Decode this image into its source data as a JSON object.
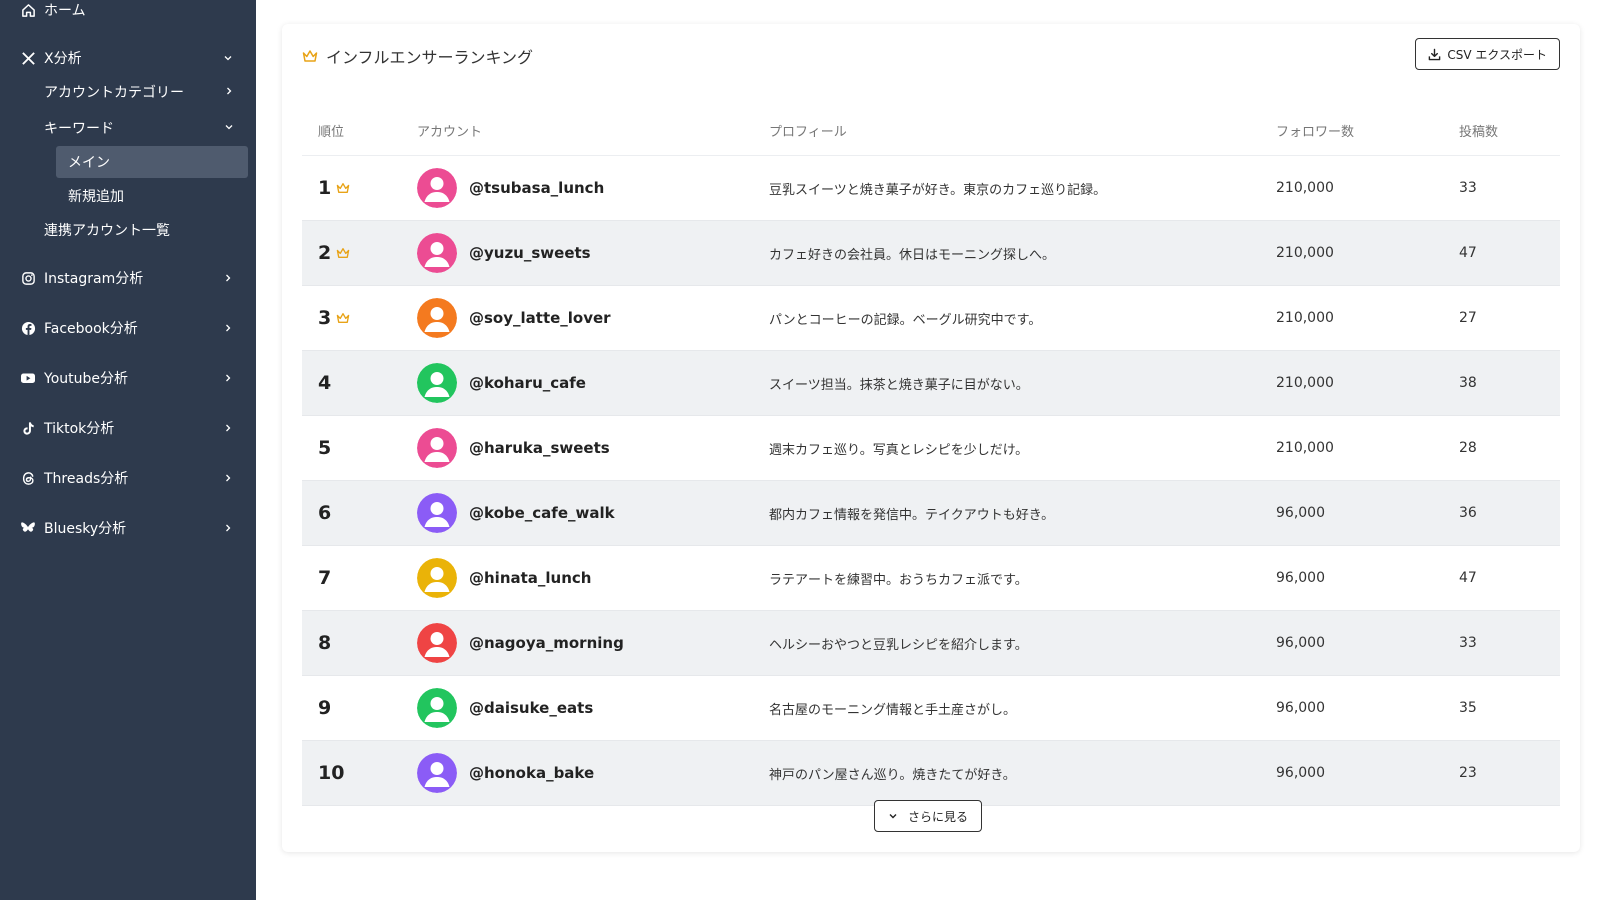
{
  "sidebar": {
    "home": "ホーム",
    "x": {
      "label": "X分析",
      "account_category": "アカウントカテゴリー",
      "keyword": "キーワード",
      "keyword_main": "メイン",
      "keyword_new": "新規追加",
      "linked_accounts": "連携アカウント一覧"
    },
    "platforms": [
      {
        "label": "Instagram分析",
        "icon": "instagram-icon"
      },
      {
        "label": "Facebook分析",
        "icon": "facebook-icon"
      },
      {
        "label": "Youtube分析",
        "icon": "youtube-icon"
      },
      {
        "label": "Tiktok分析",
        "icon": "tiktok-icon"
      },
      {
        "label": "Threads分析",
        "icon": "threads-icon"
      },
      {
        "label": "Bluesky分析",
        "icon": "bluesky-icon"
      }
    ]
  },
  "ranking": {
    "title": "インフルエンサーランキング",
    "export_label": "CSV エクスポート",
    "more_label": "さらに見る",
    "columns": {
      "rank": "順位",
      "account": "アカウント",
      "profile": "プロフィール",
      "followers": "フォロワー数",
      "posts": "投稿数"
    },
    "crown_color": "#e8a317",
    "rows": [
      {
        "rank": "1",
        "handle": "@tsubasa_lunch",
        "profile": "豆乳スイーツと焼き菓子が好き。東京のカフェ巡り記録。",
        "followers": "210,000",
        "posts": "33",
        "avatar_color": "#ec4c93",
        "crown": true
      },
      {
        "rank": "2",
        "handle": "@yuzu_sweets",
        "profile": "カフェ好きの会社員。休日はモーニング探しへ。",
        "followers": "210,000",
        "posts": "47",
        "avatar_color": "#ec4c93",
        "crown": true
      },
      {
        "rank": "3",
        "handle": "@soy_latte_lover",
        "profile": "パンとコーヒーの記録。ベーグル研究中です。",
        "followers": "210,000",
        "posts": "27",
        "avatar_color": "#f47a1f",
        "crown": true
      },
      {
        "rank": "4",
        "handle": "@koharu_cafe",
        "profile": "スイーツ担当。抹茶と焼き菓子に目がない。",
        "followers": "210,000",
        "posts": "38",
        "avatar_color": "#22c55e",
        "crown": false
      },
      {
        "rank": "5",
        "handle": "@haruka_sweets",
        "profile": "週末カフェ巡り。写真とレシピを少しだけ。",
        "followers": "210,000",
        "posts": "28",
        "avatar_color": "#ec4c93",
        "crown": false
      },
      {
        "rank": "6",
        "handle": "@kobe_cafe_walk",
        "profile": "都内カフェ情報を発信中。テイクアウトも好き。",
        "followers": "96,000",
        "posts": "36",
        "avatar_color": "#8b5cf6",
        "crown": false
      },
      {
        "rank": "7",
        "handle": "@hinata_lunch",
        "profile": "ラテアートを練習中。おうちカフェ派です。",
        "followers": "96,000",
        "posts": "47",
        "avatar_color": "#eab308",
        "crown": false
      },
      {
        "rank": "8",
        "handle": "@nagoya_morning",
        "profile": "ヘルシーおやつと豆乳レシピを紹介します。",
        "followers": "96,000",
        "posts": "33",
        "avatar_color": "#ef4444",
        "crown": false
      },
      {
        "rank": "9",
        "handle": "@daisuke_eats",
        "profile": "名古屋のモーニング情報と手土産さがし。",
        "followers": "96,000",
        "posts": "35",
        "avatar_color": "#22c55e",
        "crown": false
      },
      {
        "rank": "10",
        "handle": "@honoka_bake",
        "profile": "神戸のパン屋さん巡り。焼きたてが好き。",
        "followers": "96,000",
        "posts": "23",
        "avatar_color": "#8b5cf6",
        "crown": false
      }
    ]
  }
}
